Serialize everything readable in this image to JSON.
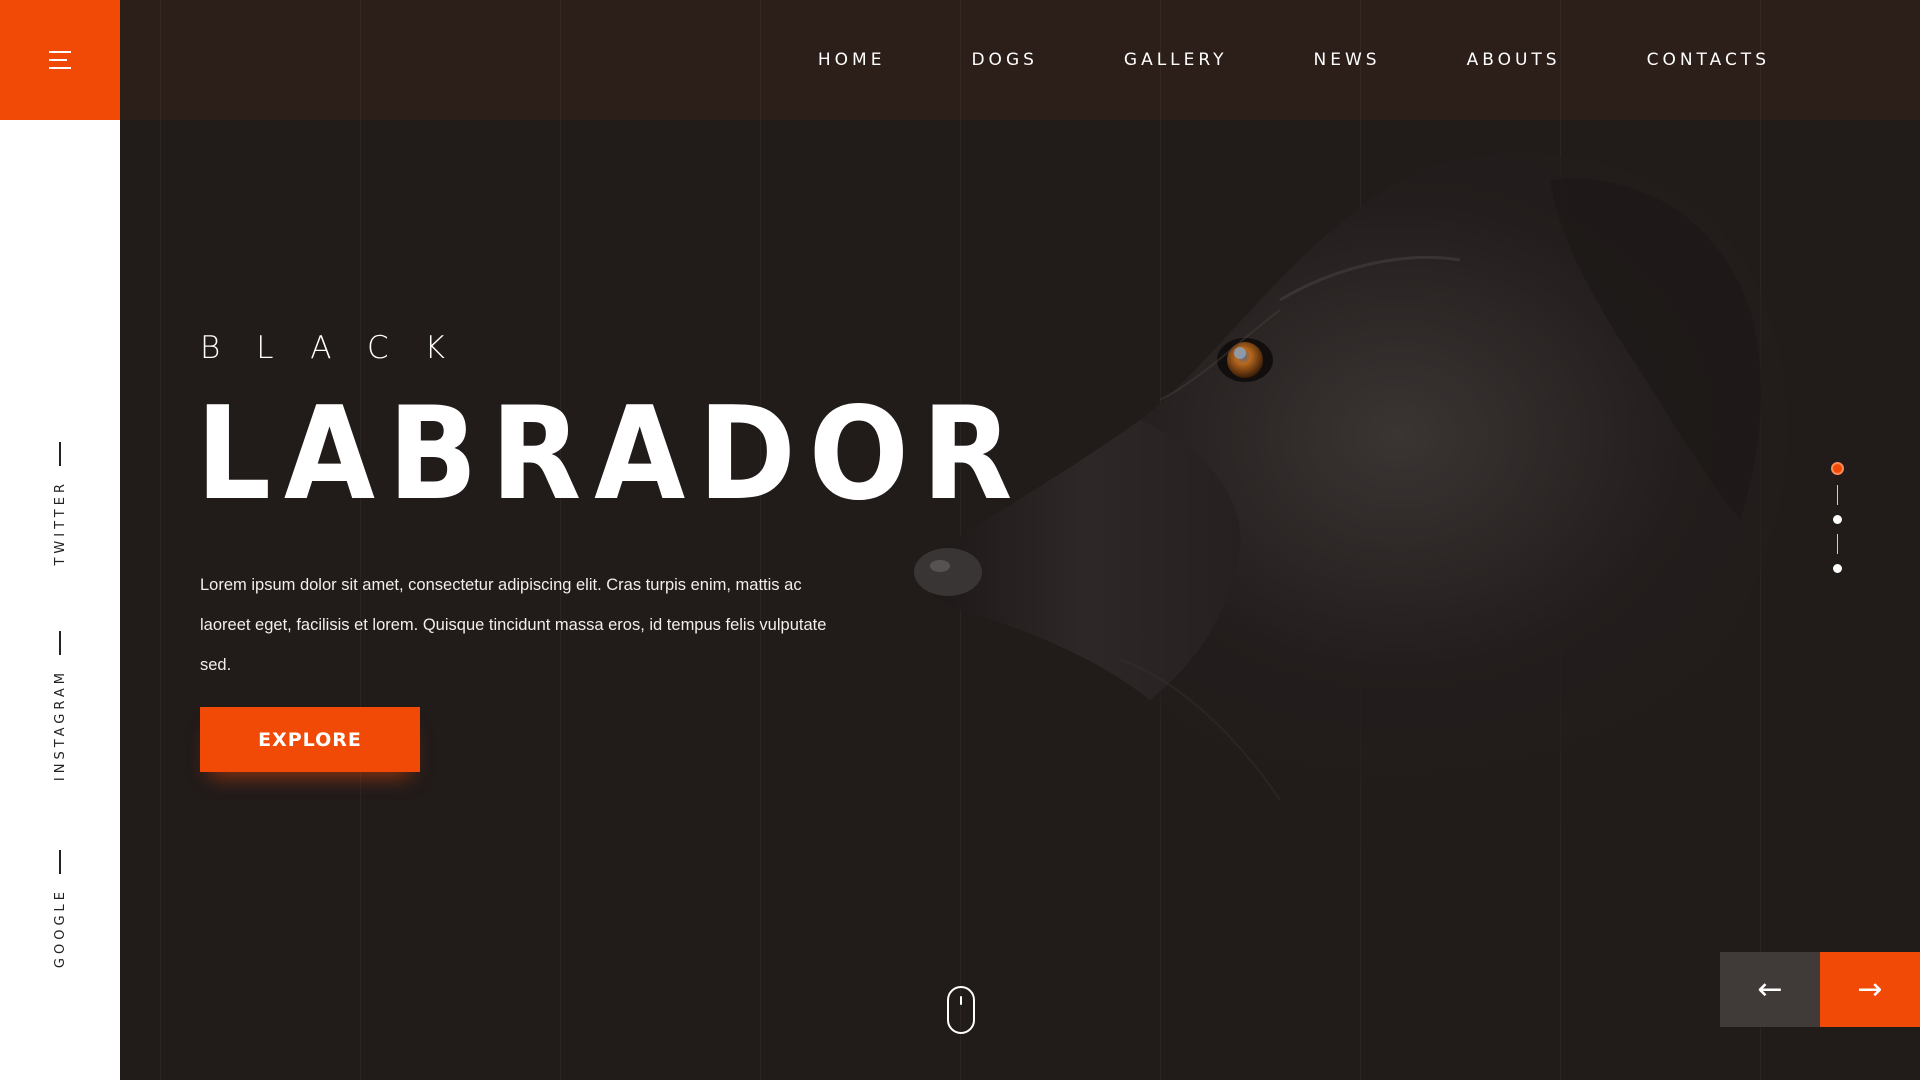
{
  "sidebar": {
    "menu_icon": "hamburger-menu-icon",
    "social": [
      {
        "label": "TWITTER"
      },
      {
        "label": "INSTAGRAM"
      },
      {
        "label": "GOOGLE"
      }
    ]
  },
  "nav": {
    "items": [
      {
        "label": "HOME"
      },
      {
        "label": "DOGS"
      },
      {
        "label": "GALLERY"
      },
      {
        "label": "NEWS"
      },
      {
        "label": "ABOUTS"
      },
      {
        "label": "CONTACTS"
      }
    ]
  },
  "hero": {
    "kicker": "BLACK",
    "title": "LABRADOR",
    "description": "Lorem ipsum dolor sit amet, consectetur adipiscing elit. Cras turpis enim, mattis ac laoreet eget, facilisis et lorem. Quisque tincidunt massa eros, id tempus felis vulputate sed.",
    "cta_label": "EXPLORE"
  },
  "slider": {
    "active_index": 0,
    "count": 3,
    "prev_icon": "arrow-left-icon",
    "next_icon": "arrow-right-icon",
    "prev_label": "←",
    "next_label": "→"
  },
  "colors": {
    "accent": "#f04a06",
    "background": "#211b1a",
    "topbar": "#2c1e19",
    "sidebar": "#ffffff"
  }
}
